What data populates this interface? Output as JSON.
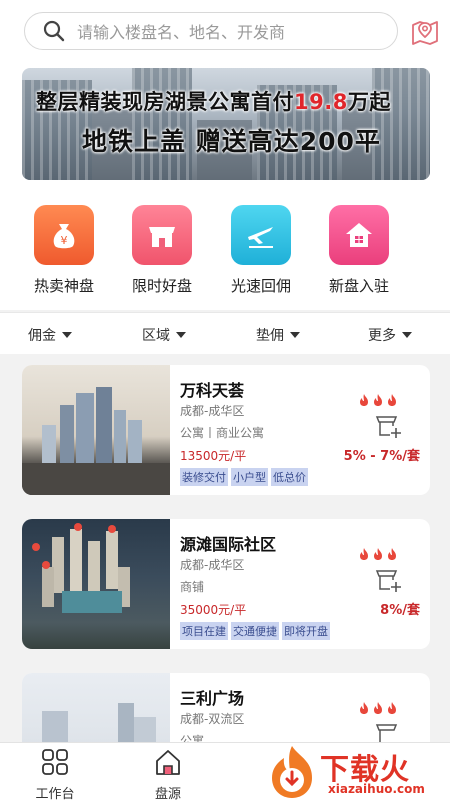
{
  "search": {
    "placeholder": "请输入楼盘名、地名、开发商"
  },
  "banner": {
    "line1_pre": "整层精装现房湖景公寓首付",
    "line1_highlight": "19.8",
    "line1_post": "万起",
    "line2": "地铁上盖   赠送高达200平",
    "highlight_color": "#e0262b"
  },
  "categories": [
    {
      "label": "热卖神盘",
      "icon": "money-bag-icon",
      "color": "#f06e3c"
    },
    {
      "label": "限时好盘",
      "icon": "store-icon",
      "color": "#f0607a"
    },
    {
      "label": "光速回佣",
      "icon": "plane-icon",
      "color": "#2cc0e0"
    },
    {
      "label": "新盘入驻",
      "icon": "house-icon",
      "color": "#f14f8a"
    }
  ],
  "filters": [
    {
      "label": "佣金"
    },
    {
      "label": "区域"
    },
    {
      "label": "垫佣"
    },
    {
      "label": "更多"
    }
  ],
  "listings": [
    {
      "name": "万科天荟",
      "location": "成都-成华区",
      "type": "公寓丨商业公寓",
      "price": "13500元/平",
      "commission": "5% - 7%/套",
      "tags": [
        "装修交付",
        "小户型",
        "低总价"
      ]
    },
    {
      "name": "源滩国际社区",
      "location": "成都-成华区",
      "type": "商铺",
      "price": "35000元/平",
      "commission": "8%/套",
      "tags": [
        "项目在建",
        "交通便捷",
        "即将开盘"
      ]
    },
    {
      "name": "三利广场",
      "location": "成都-双流区",
      "type": "公寓",
      "price": "",
      "commission": "",
      "tags": []
    }
  ],
  "bottom_nav": [
    {
      "label": "工作台",
      "icon": "grid-icon"
    },
    {
      "label": "盘源",
      "icon": "home-icon"
    }
  ],
  "watermark": {
    "text": "下载火",
    "url": "xiazaihuo.com"
  },
  "colors": {
    "accent_red": "#c8282a",
    "tag_bg": "#c9d3f0"
  }
}
